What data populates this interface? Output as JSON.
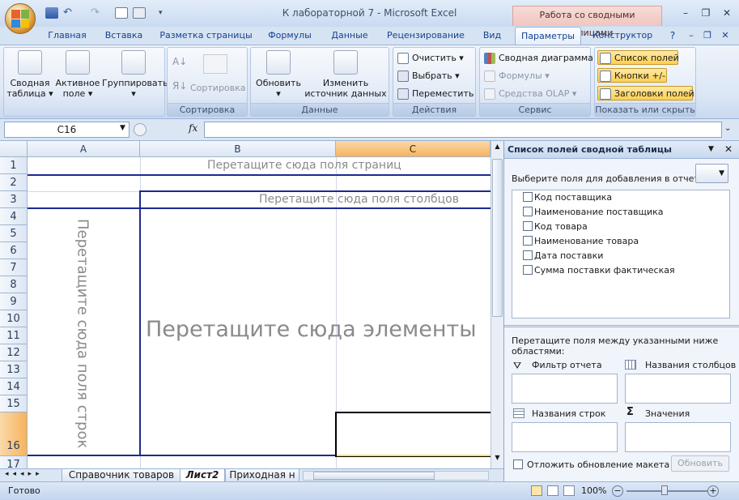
{
  "window": {
    "title": "К лабораторной 7  -  Microsoft Excel",
    "context_header": "Работа со сводными таблицами"
  },
  "tabs": [
    "Главная",
    "Вставка",
    "Разметка страницы",
    "Формулы",
    "Данные",
    "Рецензирование",
    "Вид",
    "Параметры",
    "Конструктор"
  ],
  "ribbon": {
    "pivot": {
      "label": "Сводная таблица"
    },
    "active_field": {
      "label": "Активное поле"
    },
    "group": {
      "label": "Группировать"
    },
    "sort_group": {
      "sort": "Сортировка",
      "label": "Сортировка"
    },
    "data_group": {
      "refresh": "Обновить",
      "change_source": "Изменить источник данных",
      "label": "Данные"
    },
    "actions": {
      "clear": "Очистить",
      "select": "Выбрать",
      "move": "Переместить",
      "label": "Действия"
    },
    "service": {
      "chart": "Сводная диаграмма",
      "formulas": "Формулы",
      "olap": "Средства OLAP",
      "label": "Сервис"
    },
    "show_hide": {
      "field_list": "Список полей",
      "buttons": "Кнопки +/-",
      "headers": "Заголовки полей",
      "label": "Показать или скрыть"
    }
  },
  "formula_bar": {
    "cell": "C16",
    "fx": "fx",
    "value": ""
  },
  "columns": [
    "A",
    "B",
    "C"
  ],
  "rows": [
    "1",
    "2",
    "3",
    "4",
    "5",
    "6",
    "7",
    "8",
    "9",
    "10",
    "11",
    "12",
    "13",
    "14",
    "15",
    "16",
    "17"
  ],
  "pivot_placeholders": {
    "page": "Перетащите сюда поля страниц",
    "columns": "Перетащите сюда поля столбцов",
    "rows": "Перетащите сюда поля строк",
    "data": "Перетащите сюда элементы"
  },
  "sheet_tabs": [
    "Справочник товаров",
    "Лист2",
    "Приходная н"
  ],
  "status": {
    "ready": "Готово",
    "zoom": "100%"
  },
  "panel": {
    "title": "Список полей сводной таблицы",
    "choose_label": "Выберите поля для добавления в отчет:",
    "fields": [
      "Код поставщика",
      "Наименование поставщика",
      "Код товара",
      "Наименование товара",
      "Дата поставки",
      "Сумма поставки фактическая"
    ],
    "drag_label": "Перетащите поля между указанными ниже областями:",
    "areas": {
      "filter": "Фильтр отчета",
      "columns": "Названия столбцов",
      "rows": "Названия строк",
      "values": "Значения"
    },
    "defer_label": "Отложить обновление макета",
    "update_button": "Обновить"
  }
}
